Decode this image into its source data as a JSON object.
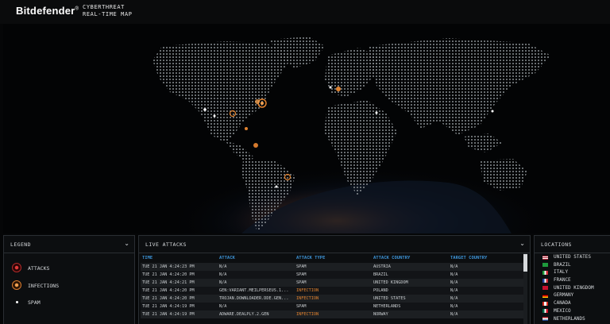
{
  "header": {
    "brand": "Bitdefender",
    "brand_mark": "®",
    "subtitle_line1": "CYBERTHREAT",
    "subtitle_line2": "REAL-TIME MAP"
  },
  "colors": {
    "attack": "#b12a2a",
    "infection": "#e0822f",
    "spam": "#ffffff",
    "column_header": "#3d93d6"
  },
  "legend": {
    "title": "LEGEND",
    "items": [
      {
        "label": "ATTACKS",
        "icon": "attack-ring-icon"
      },
      {
        "label": "INFECTIONS",
        "icon": "infection-ring-icon"
      },
      {
        "label": "SPAM",
        "icon": "spam-dot-icon"
      }
    ]
  },
  "live": {
    "title": "LIVE ATTACKS",
    "columns": [
      "TIME",
      "ATTACK",
      "ATTACK TYPE",
      "ATTACK COUNTRY",
      "TARGET COUNTRY"
    ],
    "rows": [
      [
        "TUE 21 JAN 4:24:23 PM",
        "N/A",
        "SPAM",
        "AUSTRIA",
        "N/A"
      ],
      [
        "TUE 21 JAN 4:24:20 PM",
        "N/A",
        "SPAM",
        "BRAZIL",
        "N/A"
      ],
      [
        "TUE 21 JAN 4:24:21 PM",
        "N/A",
        "SPAM",
        "UNITED KINGDOM",
        "N/A"
      ],
      [
        "TUE 21 JAN 4:24:20 PM",
        "GEN:VARIANT.MEILPERSEUS.1...",
        "INFECTION",
        "POLAND",
        "N/A"
      ],
      [
        "TUE 21 JAN 4:24:20 PM",
        "TROJAN.DOWNLOADER.DDE.GEN...",
        "INFECTION",
        "UNITED STATES",
        "N/A"
      ],
      [
        "TUE 21 JAN 4:24:19 PM",
        "N/A",
        "SPAM",
        "NETHERLANDS",
        "N/A"
      ],
      [
        "TUE 21 JAN 4:24:19 PM",
        "ADWARE.DEALPLY.2.GEN",
        "INFECTION",
        "NORWAY",
        "N/A"
      ]
    ]
  },
  "locations": {
    "title": "LOCATIONS",
    "items": [
      "UNITED STATES",
      "BRAZIL",
      "ITALY",
      "FRANCE",
      "UNITED KINGDOM",
      "GERMANY",
      "CANADA",
      "MEXICO",
      "NETHERLANDS"
    ]
  }
}
